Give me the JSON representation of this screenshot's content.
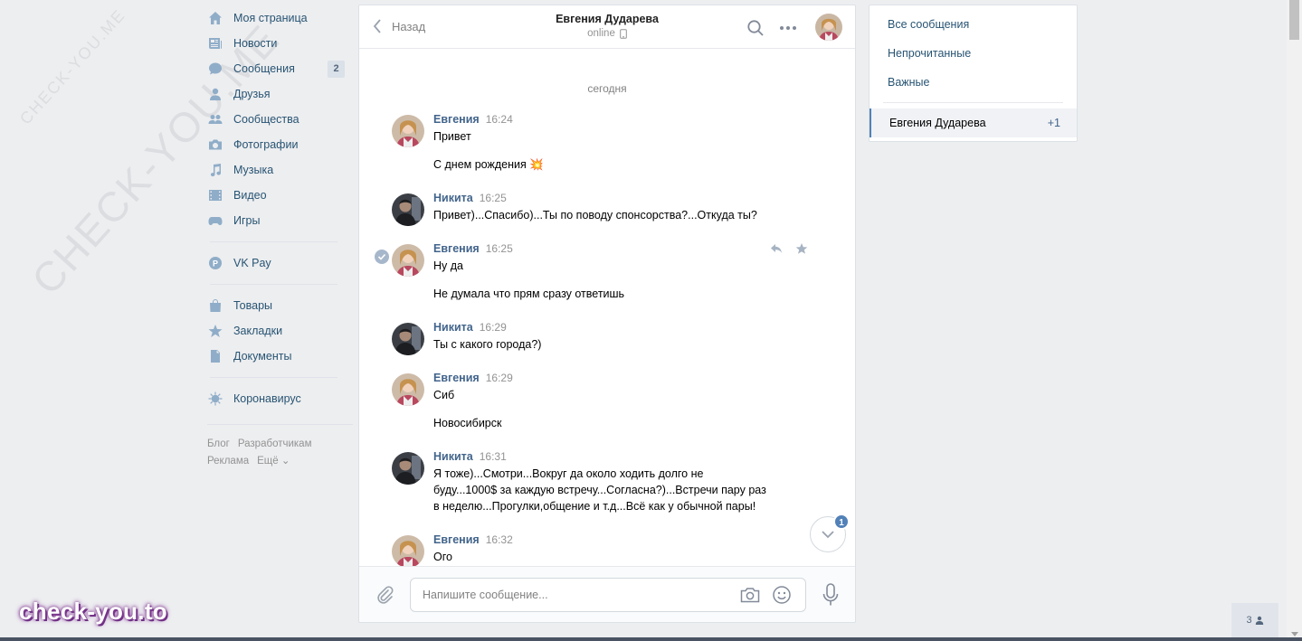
{
  "watermark": {
    "small": "CHECK-YOU.ME",
    "large": "CHECK-YOU.ME"
  },
  "brand": "check-you.to",
  "leftnav": {
    "items": [
      {
        "label": "Моя страница",
        "icon": "home-icon"
      },
      {
        "label": "Новости",
        "icon": "news-icon"
      },
      {
        "label": "Сообщения",
        "icon": "messages-icon",
        "count": "2"
      },
      {
        "label": "Друзья",
        "icon": "friend-icon"
      },
      {
        "label": "Сообщества",
        "icon": "groups-icon"
      },
      {
        "label": "Фотографии",
        "icon": "camera-icon"
      },
      {
        "label": "Музыка",
        "icon": "music-icon"
      },
      {
        "label": "Видео",
        "icon": "video-icon"
      },
      {
        "label": "Игры",
        "icon": "gamepad-icon"
      }
    ],
    "vkpay": {
      "label": "VK Pay",
      "icon": "vkpay-icon"
    },
    "items2": [
      {
        "label": "Товары",
        "icon": "bag-icon"
      },
      {
        "label": "Закладки",
        "icon": "star-icon"
      },
      {
        "label": "Документы",
        "icon": "document-icon"
      }
    ],
    "covid": {
      "label": "Коронавирус",
      "icon": "virus-icon"
    },
    "footer": {
      "blog": "Блог",
      "dev": "Разработчикам",
      "ads": "Реклама",
      "more": "Ещё ⌄"
    }
  },
  "chat": {
    "back_label": "Назад",
    "peer_name": "Евгения Дударева",
    "peer_status": "online",
    "day_label": "сегодня",
    "messages": [
      {
        "author": "Евгения",
        "time": "16:24",
        "lines": [
          "Привет",
          "С днем рождения 💥"
        ]
      },
      {
        "author": "Никита",
        "time": "16:25",
        "lines": [
          "Привет)...Спасибо)...Ты по поводу спонсорства?...Откуда ты?"
        ]
      },
      {
        "author": "Евгения",
        "time": "16:25",
        "lines": [
          "Ну да",
          "Не думала что прям сразу ответишь"
        ]
      },
      {
        "author": "Никита",
        "time": "16:29",
        "lines": [
          "Ты с какого города?)"
        ]
      },
      {
        "author": "Евгения",
        "time": "16:29",
        "lines": [
          "Сиб",
          "Новосибирск"
        ]
      },
      {
        "author": "Никита",
        "time": "16:31",
        "lines": [
          "Я тоже)...Смотри...Вокруг да около ходить долго не",
          "буду...1000$ за каждую встречу...Согласна?)...Встречи пару раз",
          "в неделю...Прогулки,общение и т.д...Всё как у обычной пары!"
        ]
      },
      {
        "author": "Евгения",
        "time": "16:32",
        "lines": [
          "Ого"
        ]
      }
    ],
    "unread_badge": "1",
    "composer_placeholder": "Напишите сообщение..."
  },
  "rightnav": {
    "all": "Все сообщения",
    "unread": "Непрочитанные",
    "important": "Важные",
    "active_name": "Евгения Дударева",
    "active_count": "+1"
  },
  "online_friends": "3",
  "colors": {
    "link": "#285473",
    "accent": "#5181b8",
    "author": "#42648b",
    "background": "#edeef0"
  }
}
